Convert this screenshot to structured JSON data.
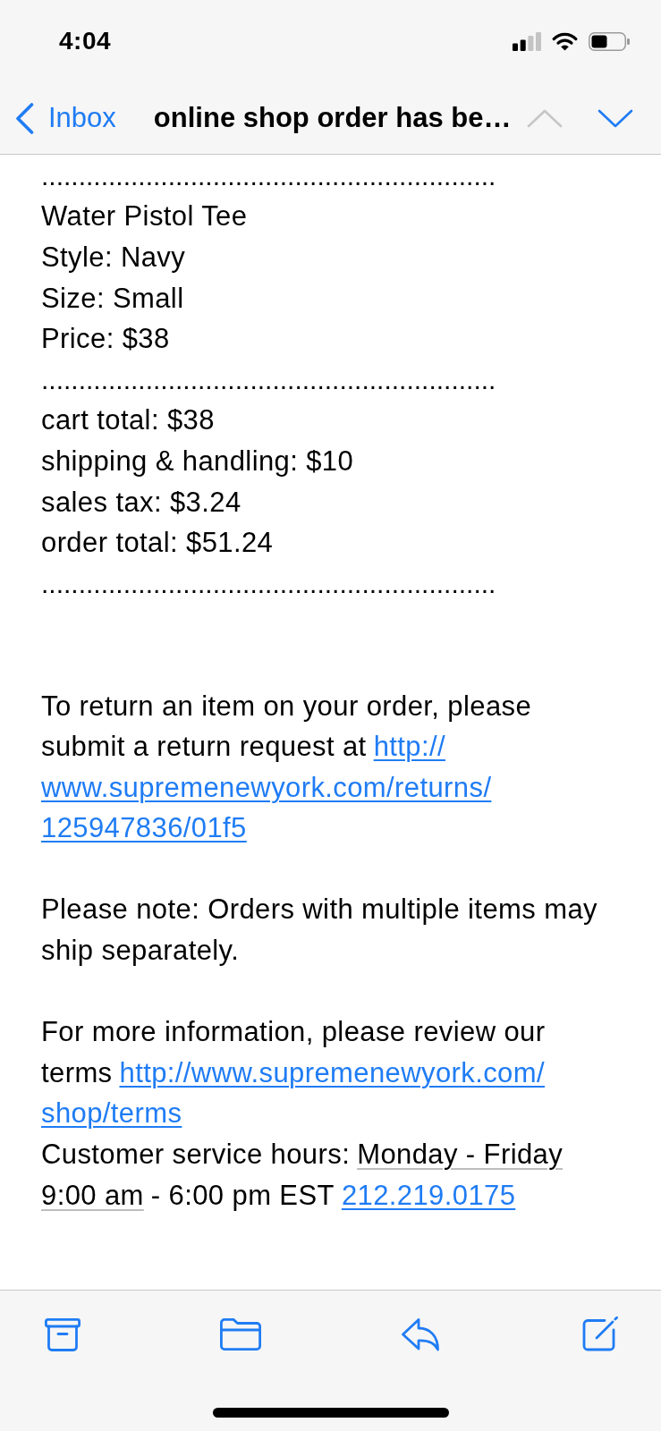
{
  "status_bar": {
    "time": "4:04"
  },
  "nav_bar": {
    "back_label": "Inbox",
    "title": "online shop order has be…",
    "arrows": [
      {
        "kind": "previous",
        "disabled": true
      },
      {
        "kind": "next",
        "disabled": false
      }
    ]
  },
  "message": {
    "order_summary": {
      "sections": [
        {
          "separator_above": ".............................................................",
          "lines": [
            "Water Pistol Tee",
            "Style: Navy",
            "Size: Small",
            "Price: $38"
          ]
        },
        {
          "separator_above": ".............................................................",
          "lines": [
            "cart total: $38",
            "shipping & handling: $10",
            "sales tax: $3.24",
            "order total: $51.24"
          ]
        }
      ],
      "closing_separator": "............................................................."
    },
    "paragraphs": [
      {
        "lines": [
          [
            {
              "kind": "text",
              "text": "To return an item on your order, please"
            }
          ],
          [
            {
              "kind": "text",
              "text": "submit a return request at"
            },
            {
              "kind": "link",
              "text": "http://"
            }
          ],
          [
            {
              "kind": "link",
              "text": "www.supremenewyork.com/returns/"
            }
          ],
          [
            {
              "kind": "link",
              "text": "125947836/01f5"
            }
          ]
        ]
      },
      {
        "lines": [
          [
            {
              "kind": "text",
              "text": "Please note: Orders with multiple items may"
            }
          ],
          [
            {
              "kind": "text",
              "text": "ship separately."
            }
          ]
        ]
      },
      {
        "lines": [
          [
            {
              "kind": "text",
              "text": "For more information, please review our"
            }
          ],
          [
            {
              "kind": "text",
              "text": "terms"
            },
            {
              "kind": "link",
              "text": "http://www.supremenewyork.com/"
            }
          ],
          [
            {
              "kind": "link",
              "text": "shop/terms"
            }
          ],
          [
            {
              "kind": "text",
              "text": "Customer service hours:"
            },
            {
              "kind": "detected",
              "text": "Monday - Friday"
            }
          ],
          [
            {
              "kind": "detected",
              "text": "9:00 am"
            },
            {
              "kind": "text",
              "text": "- 6:00 pm EST"
            },
            {
              "kind": "link",
              "text": "212.219.0175"
            }
          ]
        ]
      }
    ]
  }
}
